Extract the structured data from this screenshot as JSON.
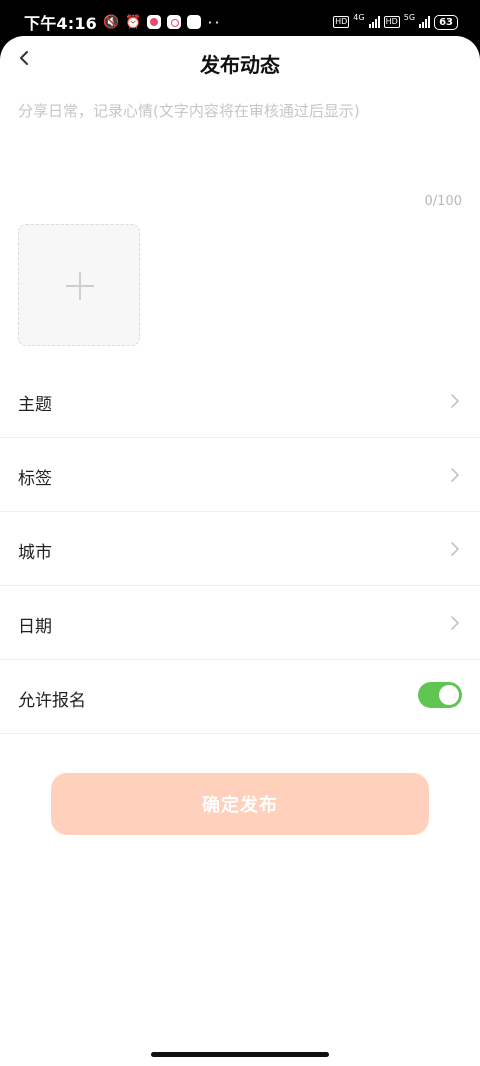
{
  "status_bar": {
    "time": "下午4:16",
    "hd1": "HD",
    "net1": "4G",
    "hd2": "HD",
    "net2": "5G",
    "battery": "63",
    "more": "··"
  },
  "header": {
    "title": "发布动态",
    "back_icon": "chevron-left-icon"
  },
  "content": {
    "value": "",
    "placeholder": "分享日常，记录心情(文字内容将在审核通过后显示)",
    "counter": "0/100"
  },
  "upload": {
    "icon": "plus-icon"
  },
  "options": [
    {
      "label": "主题"
    },
    {
      "label": "标签"
    },
    {
      "label": "城市"
    },
    {
      "label": "日期"
    }
  ],
  "allow_signup": {
    "label": "允许报名",
    "enabled": true,
    "color": "#61c554"
  },
  "submit": {
    "label": "确定发布",
    "color": "#ffd0bc"
  }
}
